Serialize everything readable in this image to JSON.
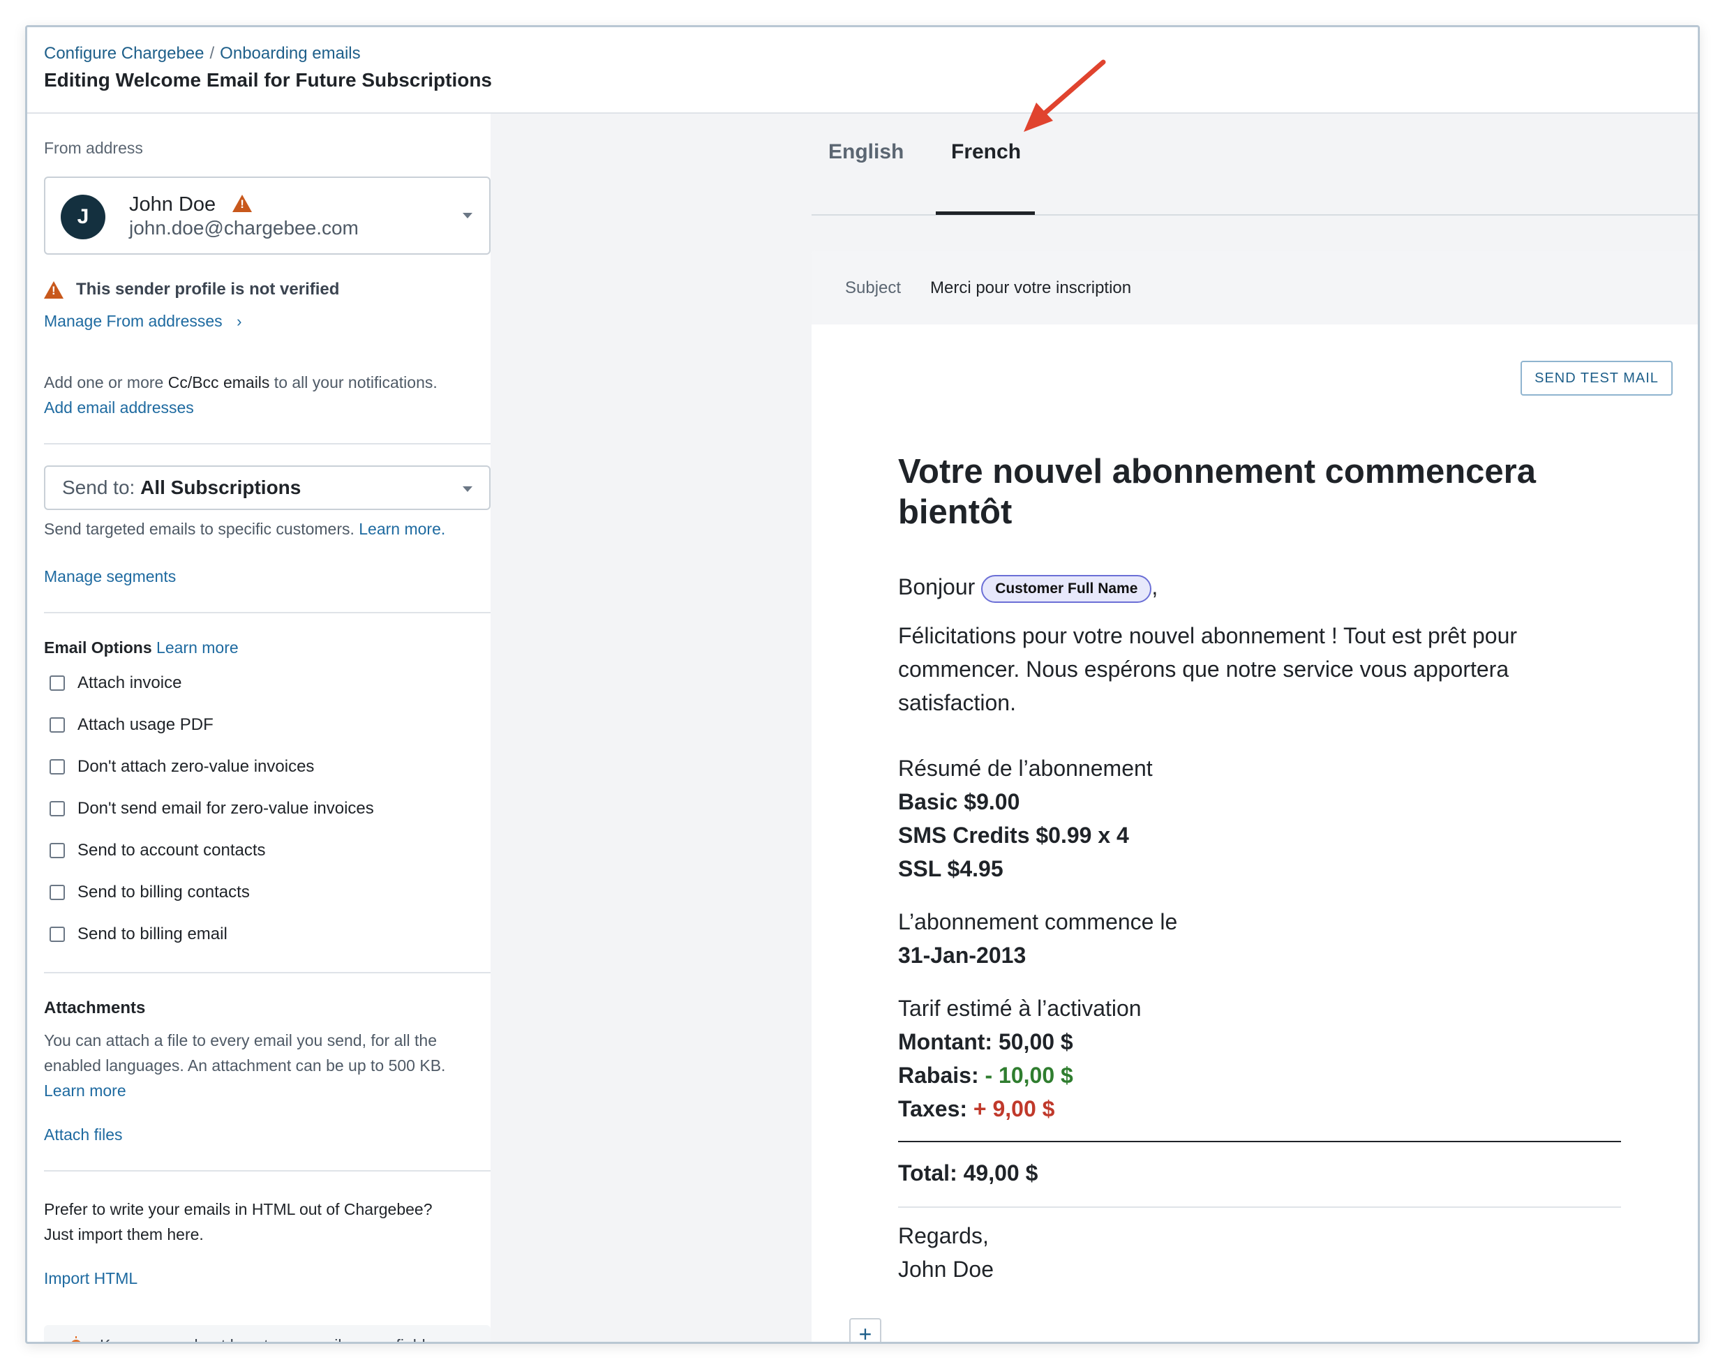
{
  "breadcrumb": {
    "parent": "Configure Chargebee",
    "separator": "/",
    "current": "Onboarding emails"
  },
  "page_title": "Editing Welcome Email for Future Subscriptions",
  "from": {
    "label": "From address",
    "avatar_initial": "J",
    "name": "John Doe",
    "email": "john.doe@chargebee.com",
    "warning": "This sender profile is not verified",
    "manage_link": "Manage From addresses"
  },
  "cc": {
    "text_before": "Add one or more ",
    "text_emph": "Cc/Bcc emails",
    "text_after": " to all your notifications.",
    "link": "Add email addresses"
  },
  "send_to": {
    "label": "Send to:",
    "value": "All Subscriptions",
    "helper": "Send targeted emails to specific customers.",
    "helper_link": "Learn more.",
    "manage_segments": "Manage segments"
  },
  "email_options": {
    "title": "Email Options",
    "learn_more": "Learn more",
    "items": [
      "Attach invoice",
      "Attach usage PDF",
      "Don't attach zero-value invoices",
      "Don't send email for zero-value invoices",
      "Send to account contacts",
      "Send to billing contacts",
      "Send to billing email"
    ]
  },
  "attachments": {
    "title": "Attachments",
    "line1": "You can attach a file to every email you send, for all the",
    "line2": "enabled languages. An attachment can be up to 500 KB.",
    "learn_more": "Learn more",
    "attach_files": "Attach files"
  },
  "import": {
    "line1": "Prefer to write your emails in HTML out of Chargebee?",
    "line2": "Just import them here.",
    "link": "Import HTML"
  },
  "tip": {
    "text": "Know more about how to use mail merge fields",
    "icon": "lightbulb-icon"
  },
  "tabs": {
    "english": "English",
    "french": "French",
    "active": "French"
  },
  "subject": {
    "label": "Subject",
    "value": "Merci pour votre inscription"
  },
  "send_test_mail": "SEND TEST MAIL",
  "email_body": {
    "heading_line1": "Votre nouvel abonnement commencera",
    "heading_line2": "bientôt",
    "greeting": "Bonjour",
    "merge_field": "Customer Full Name",
    "greeting_suffix": ",",
    "para_line1": "Félicitations pour votre nouvel abonnement ! Tout est prêt pour",
    "para_line2": "commencer. Nous espérons que notre service vous apportera",
    "para_line3": "satisfaction.",
    "summary_title": "Résumé de l’abonnement",
    "summary_items": [
      "Basic $9.00",
      "SMS Credits $0.99 x 4",
      "SSL $4.95"
    ],
    "start_label": "L’abonnement commence le",
    "start_date": "31-Jan-2013",
    "estimate_title": "Tarif estimé à l’activation",
    "amount_label": "Montant:",
    "amount_value": "50,00 $",
    "discount_label": "Rabais:",
    "discount_value": "- 10,00 $",
    "tax_label": "Taxes:",
    "tax_value": "+ 9,00 $",
    "total_label": "Total:",
    "total_value": "49,00 $",
    "regards": "Regards,",
    "signature": "John Doe"
  },
  "colors": {
    "link": "#1e6aa0",
    "warning": "#c8581c",
    "discount": "#2f7d2f",
    "tax": "#c0392b",
    "arrow": "#e0432e",
    "pill_border": "#6b6fd6"
  }
}
